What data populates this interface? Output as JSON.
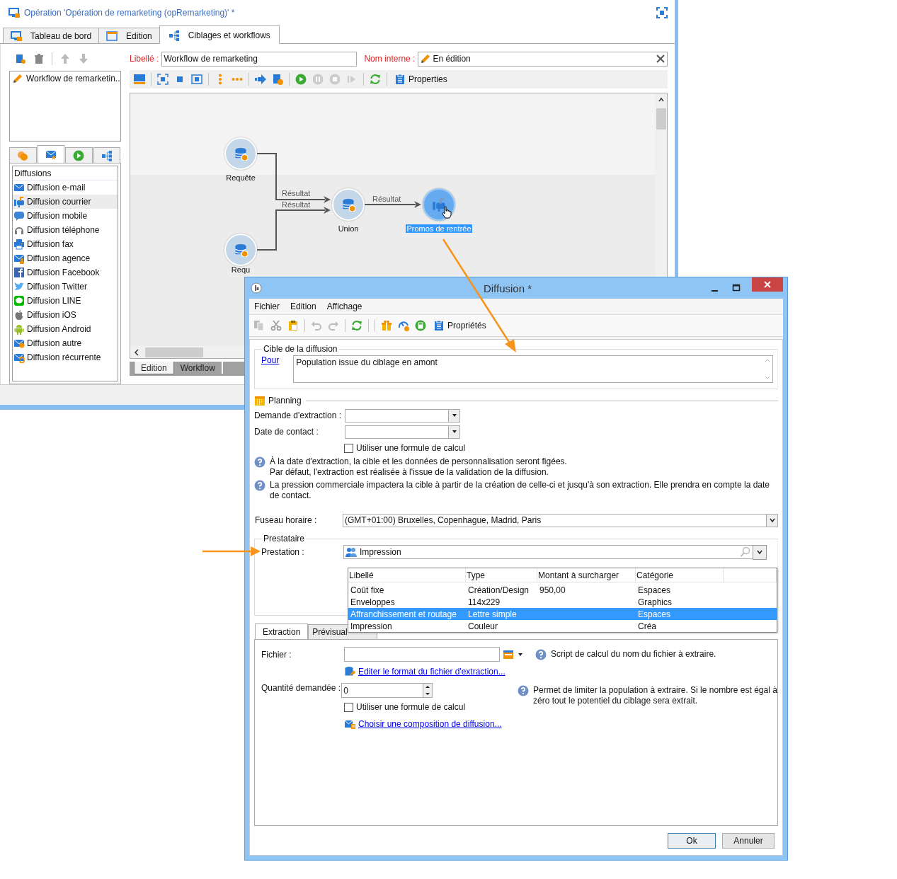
{
  "window": {
    "title": "Opération 'Opération de remarketing (opRemarketing)' *",
    "tabs": [
      {
        "label": "Tableau de bord",
        "selected": false
      },
      {
        "label": "Edition",
        "selected": false
      },
      {
        "label": "Ciblages et workflows",
        "selected": true
      }
    ]
  },
  "workflow_list": {
    "items": [
      {
        "label": "Workflow de remarketin..",
        "selected": false
      }
    ]
  },
  "palette": {
    "tabs": [
      {
        "selected": false
      },
      {
        "selected": true
      },
      {
        "selected": false
      },
      {
        "selected": false
      }
    ],
    "header": "Diffusions",
    "items": [
      {
        "label": "Diffusion e-mail",
        "selected": false
      },
      {
        "label": "Diffusion courrier",
        "selected": true
      },
      {
        "label": "Diffusion mobile",
        "selected": false
      },
      {
        "label": "Diffusion téléphone",
        "selected": false
      },
      {
        "label": "Diffusion fax",
        "selected": false
      },
      {
        "label": "Diffusion agence",
        "selected": false
      },
      {
        "label": "Diffusion Facebook",
        "selected": false
      },
      {
        "label": "Diffusion Twitter",
        "selected": false
      },
      {
        "label": "Diffusion LINE",
        "selected": false
      },
      {
        "label": "Diffusion iOS",
        "selected": false
      },
      {
        "label": "Diffusion Android",
        "selected": false
      },
      {
        "label": "Diffusion autre",
        "selected": false
      },
      {
        "label": "Diffusion récurrente",
        "selected": false
      }
    ]
  },
  "form": {
    "label_field": {
      "label": "Libellé :",
      "value": "Workflow de remarketing"
    },
    "internal_name": {
      "label": "Nom interne :",
      "value": "En édition"
    }
  },
  "toolbar": {
    "properties": "Properties"
  },
  "workflow": {
    "nodes": [
      {
        "kind": "query",
        "label": "Requête",
        "selected": false
      },
      {
        "kind": "query",
        "label": "Requ",
        "selected": false
      },
      {
        "kind": "union",
        "label": "Union",
        "selected": false
      },
      {
        "kind": "delivery",
        "label": "Promos de rentrée",
        "selected": true
      }
    ],
    "transitions": [
      {
        "label": "Résultat"
      },
      {
        "label": "Résultat"
      },
      {
        "label": "Résultat"
      }
    ]
  },
  "bottom_tabs": [
    {
      "label": "Edition",
      "selected": true
    },
    {
      "label": "Workflow",
      "selected": false
    }
  ],
  "dialog": {
    "title": "Diffusion *",
    "menu": [
      "Fichier",
      "Edition",
      "Affichage"
    ],
    "toolbar": {
      "properties": "Propriétés"
    },
    "target": {
      "title": "Cible de la diffusion",
      "link": "Pour",
      "value": "Population issue du ciblage en amont"
    },
    "planning": {
      "title": "Planning",
      "fields": [
        {
          "label": "Demande d'extraction :"
        },
        {
          "label": "Date de contact :"
        }
      ],
      "formula": {
        "label": "Utiliser une formule de calcul",
        "checked": false
      },
      "notes": [
        {
          "lines": [
            "À la date d'extraction, la cible et les données de personnalisation seront figées.",
            "Par défaut, l'extraction est réalisée à l'issue de la validation de la diffusion."
          ]
        },
        {
          "lines": [
            "La pression commerciale impactera la cible à partir de la création de celle-ci et jusqu'à son extraction. Elle prendra en compte la date de contact."
          ]
        }
      ]
    },
    "timezone": {
      "label": "Fuseau horaire :",
      "value": "(GMT+01:00) Bruxelles, Copenhague, Madrid, Paris"
    },
    "provider": {
      "title": "Prestataire",
      "label": "Prestation :",
      "value": "Impression",
      "dropdown": {
        "columns": [
          "Libellé",
          "Type",
          "Montant à surcharger",
          "Catégorie"
        ],
        "rows": [
          {
            "label": "Coût fixe",
            "type": "Création/Design",
            "amount": "950,00",
            "category": "Espaces",
            "selected": false
          },
          {
            "label": "Enveloppes",
            "type": "114x229",
            "category": "Graphics",
            "selected": false
          },
          {
            "label": "Affranchissement et routage",
            "type": "Lettre simple",
            "category": "Espaces",
            "selected": true
          },
          {
            "label": "Impression",
            "type": "Couleur",
            "category": "Créa",
            "selected": false
          }
        ]
      }
    },
    "tabs": [
      {
        "label": "Extraction",
        "selected": true
      },
      {
        "label": "Prévisual",
        "selected": false
      }
    ],
    "extraction": {
      "file": {
        "label": "Fichier :",
        "help": "Script de calcul du nom du fichier à extraire."
      },
      "format_link": "Editer le format du fichier d'extraction...",
      "quantity": {
        "label": "Quantité demandée :",
        "value": "0",
        "help": "Permet de limiter la population à extraire. Si le nombre est égal à zéro tout le potentiel du ciblage sera extrait."
      },
      "formula": {
        "label": "Utiliser une formule de calcul",
        "checked": false
      },
      "composition_link": "Choisir une composition de diffusion..."
    },
    "buttons": [
      {
        "label": "Ok",
        "default": true
      },
      {
        "label": "Annuler",
        "default": false
      }
    ]
  }
}
